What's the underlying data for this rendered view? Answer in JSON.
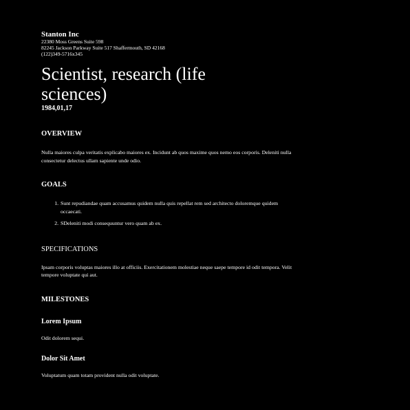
{
  "company": {
    "name": "Stanton Inc",
    "address_1": "22380 Moss Greens Suite 598",
    "address_2": "82245 Jackson Parkway Suite 517 Shaffermouth, SD 42168",
    "phone": "(122)349-5716x345"
  },
  "document": {
    "title": "Scientist, research (life sciences)",
    "date": "1984,01,17"
  },
  "overview": {
    "heading": "OVERVIEW",
    "text": "Nulla maiores culpa veritatis explicabo maiores ex. Incidunt ab quos maxime quos nemo eos corporis. Deleniti nulla consectetur delectus ullam sapiente unde odio."
  },
  "goals": {
    "heading": "GOALS",
    "items": [
      "Sunt repudiandae quam accusamus quidem nulla quis repellat rem sed architecto doloremque quidem occaecati.",
      "SDeleniti modi consequuntur vero quam ab ex."
    ]
  },
  "specifications": {
    "heading": "SPECIFICATIONS",
    "text": "Ipsam corporis voluptas maiores illo at officiis. Exercitationem molestiae neque saepe tempore id odit tempora. Velit tempore voluptate qui aut."
  },
  "milestones": {
    "heading": "MILESTONES",
    "items": [
      {
        "title": "Lorem Ipsum",
        "text": "Odit dolorem sequi."
      },
      {
        "title": "Dolor Sit Amet",
        "text": "Voluptatum quam totam provident nulla odit voluptate."
      }
    ]
  }
}
